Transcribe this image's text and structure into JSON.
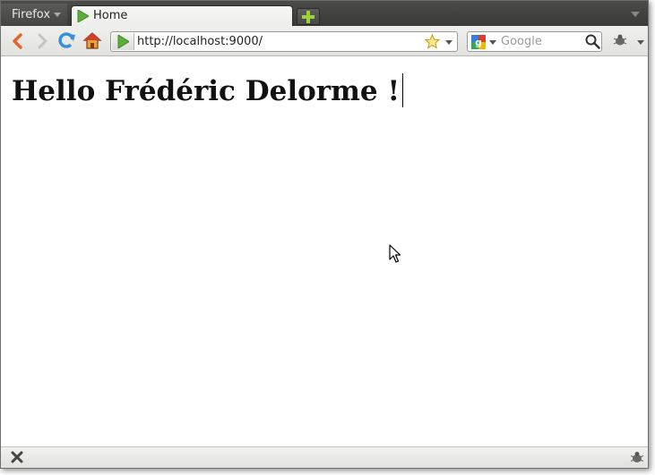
{
  "browser": {
    "menu_label": "Firefox",
    "tab_title": "Home",
    "url": "http://localhost:9000/",
    "search_placeholder": "Google"
  },
  "page": {
    "heading": "Hello Frédéric Delorme !"
  },
  "icons": {
    "back": "back-arrow-icon",
    "forward": "forward-arrow-icon",
    "reload": "reload-icon",
    "home": "home-icon",
    "site": "play-favicon-icon",
    "bookmark": "star-icon",
    "search_engine": "google-icon",
    "search_go": "magnifier-icon",
    "new_tab": "plus-icon",
    "stop": "close-icon",
    "addon": "bug-icon"
  },
  "colors": {
    "tabbar": "#3f3f3d",
    "play_green": "#5fad3c",
    "back_orange": "#e4652b",
    "reload_blue": "#3b8fd6"
  }
}
